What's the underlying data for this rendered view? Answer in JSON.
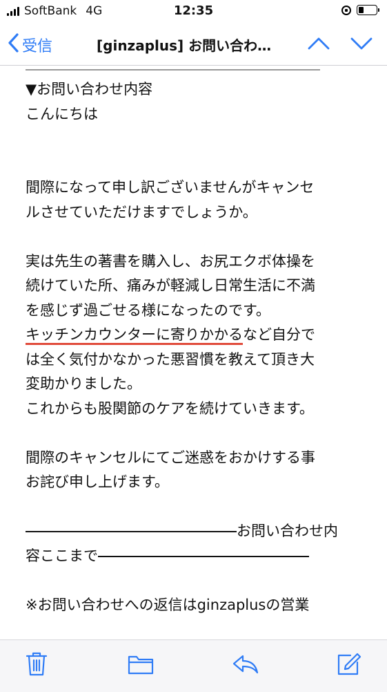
{
  "status_bar": {
    "carrier": "SoftBank",
    "network": "4G",
    "time": "12:35",
    "battery_level": 0.3
  },
  "nav": {
    "back_label": "受信",
    "title": "[ginzaplus] お問い合わ…",
    "icons": [
      "chevron-left-icon",
      "chevron-up-icon",
      "chevron-down-icon"
    ]
  },
  "mail": {
    "lines": {
      "heading": "▼お問い合わせ内容",
      "greeting": "こんにちは",
      "p1a": "間際になって申し訳ございませんがキャンセ",
      "p1b": "ルさせていただけますでしょうか。",
      "p2a": "実は先生の著書を購入し、お尻エクボ体操を",
      "p2b": "続けていた所、痛みが軽減し日常生活に不満",
      "p2c": "を感じず過ごせる様になったのです。",
      "p2d_highlight": "キッチンカウンターに寄りかかる",
      "p2d_rest": "など自分で",
      "p2e": "は全く気付かなかった悪習慣を教えて頂き大",
      "p2f": "変助かりました。",
      "p2g": "これからも股関節のケアを続けていきます。",
      "p3a": "間際のキャンセルにてご迷惑をおかけする事",
      "p3b": "お詫び申し上げます。",
      "footer_a": "お問い合わせ内",
      "footer_b": "容ここまで",
      "note": "※お問い合わせへの返信はginzaplusの営業"
    },
    "highlight_color": "#e04a3a"
  },
  "toolbar": {
    "icons": [
      "trash-icon",
      "folder-icon",
      "reply-icon",
      "compose-icon"
    ],
    "accent": "#2f7cf6"
  }
}
